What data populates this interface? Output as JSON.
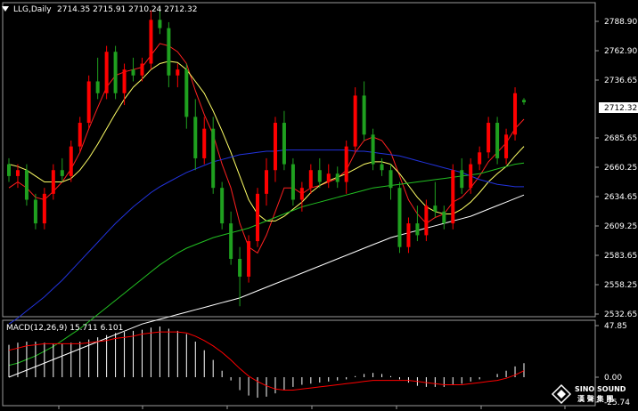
{
  "window": {
    "symbol_title": "LLG,Daily",
    "ohlc_text": "2714.35 2715.91 2710.24 2712.32"
  },
  "price_axis": {
    "ticks": [
      "2788.90",
      "2762.90",
      "2736.65",
      "2712.32",
      "2685.65",
      "2660.25",
      "2634.65",
      "2609.25",
      "2583.65",
      "2558.25",
      "2532.65"
    ],
    "current_price": "2712.32"
  },
  "macd_panel": {
    "label": "MACD(12,26,9) 15.711 6.101",
    "ticks": [
      "47.85",
      "0.00",
      "-25.74"
    ]
  },
  "watermark": {
    "brand_en": "SINO SOUND",
    "brand_cn": "漢 聲 集 團"
  },
  "colors": {
    "background": "#000000",
    "bull_candle": "#ff0000",
    "bear_candle": "#1fa01f",
    "ma_fast": "#ff2020",
    "ma_slow": "#ffff66",
    "ma_mid": "#22c022",
    "ma_blue": "#2233dd",
    "ma_long": "#ffffff",
    "macd_hist": "#ffffff",
    "macd_signal": "#ff0000"
  },
  "chart_data": {
    "type": "candlestick",
    "ylim": [
      2532.65,
      2795
    ],
    "candles": [
      [
        2660,
        2665,
        2645,
        2650
      ],
      [
        2650,
        2660,
        2640,
        2655
      ],
      [
        2655,
        2660,
        2625,
        2630
      ],
      [
        2630,
        2635,
        2605,
        2610
      ],
      [
        2610,
        2640,
        2605,
        2635
      ],
      [
        2635,
        2660,
        2630,
        2655
      ],
      [
        2655,
        2665,
        2645,
        2650
      ],
      [
        2650,
        2680,
        2645,
        2675
      ],
      [
        2675,
        2700,
        2670,
        2695
      ],
      [
        2695,
        2735,
        2690,
        2730
      ],
      [
        2730,
        2750,
        2715,
        2720
      ],
      [
        2720,
        2760,
        2715,
        2755
      ],
      [
        2755,
        2760,
        2715,
        2720
      ],
      [
        2720,
        2745,
        2710,
        2740
      ],
      [
        2740,
        2750,
        2730,
        2735
      ],
      [
        2735,
        2750,
        2730,
        2745
      ],
      [
        2745,
        2790,
        2740,
        2782
      ],
      [
        2782,
        2792,
        2770,
        2775
      ],
      [
        2775,
        2780,
        2725,
        2735
      ],
      [
        2735,
        2745,
        2725,
        2740
      ],
      [
        2740,
        2745,
        2690,
        2700
      ],
      [
        2700,
        2715,
        2655,
        2665
      ],
      [
        2665,
        2700,
        2660,
        2690
      ],
      [
        2690,
        2700,
        2635,
        2640
      ],
      [
        2640,
        2645,
        2605,
        2610
      ],
      [
        2610,
        2620,
        2575,
        2580
      ],
      [
        2580,
        2590,
        2540,
        2565
      ],
      [
        2565,
        2600,
        2560,
        2595
      ],
      [
        2595,
        2640,
        2590,
        2635
      ],
      [
        2635,
        2665,
        2625,
        2655
      ],
      [
        2655,
        2700,
        2645,
        2695
      ],
      [
        2695,
        2705,
        2655,
        2660
      ],
      [
        2660,
        2665,
        2625,
        2630
      ],
      [
        2630,
        2645,
        2620,
        2640
      ],
      [
        2640,
        2660,
        2635,
        2655
      ],
      [
        2655,
        2665,
        2640,
        2645
      ],
      [
        2645,
        2660,
        2640,
        2652
      ],
      [
        2652,
        2658,
        2640,
        2645
      ],
      [
        2645,
        2680,
        2635,
        2675
      ],
      [
        2675,
        2725,
        2670,
        2718
      ],
      [
        2718,
        2730,
        2680,
        2685
      ],
      [
        2685,
        2690,
        2655,
        2660
      ],
      [
        2660,
        2665,
        2650,
        2655
      ],
      [
        2655,
        2660,
        2630,
        2640
      ],
      [
        2640,
        2645,
        2585,
        2590
      ],
      [
        2590,
        2615,
        2585,
        2610
      ],
      [
        2610,
        2625,
        2595,
        2600
      ],
      [
        2600,
        2630,
        2595,
        2625
      ],
      [
        2625,
        2645,
        2615,
        2620
      ],
      [
        2620,
        2625,
        2605,
        2610
      ],
      [
        2610,
        2660,
        2605,
        2655
      ],
      [
        2655,
        2665,
        2635,
        2640
      ],
      [
        2640,
        2665,
        2635,
        2660
      ],
      [
        2660,
        2675,
        2655,
        2670
      ],
      [
        2670,
        2700,
        2665,
        2695
      ],
      [
        2695,
        2700,
        2660,
        2665
      ],
      [
        2665,
        2690,
        2660,
        2685
      ],
      [
        2685,
        2725,
        2680,
        2720
      ],
      [
        2714.35,
        2715.91,
        2710.24,
        2712.32
      ]
    ],
    "overlays": [
      {
        "name": "ma_fast",
        "color": "#ff2020",
        "values": [
          2640,
          2645,
          2640,
          2632,
          2630,
          2637,
          2645,
          2656,
          2670,
          2690,
          2708,
          2725,
          2735,
          2738,
          2740,
          2742,
          2752,
          2762,
          2760,
          2755,
          2745,
          2722,
          2702,
          2685,
          2660,
          2640,
          2610,
          2590,
          2585,
          2600,
          2620,
          2640,
          2640,
          2635,
          2640,
          2642,
          2645,
          2648,
          2655,
          2670,
          2680,
          2683,
          2680,
          2670,
          2650,
          2630,
          2618,
          2610,
          2615,
          2618,
          2628,
          2632,
          2640,
          2650,
          2662,
          2670,
          2678,
          2690,
          2698
        ]
      },
      {
        "name": "ma_slow",
        "color": "#ffff66",
        "values": [
          2660,
          2658,
          2655,
          2650,
          2645,
          2645,
          2645,
          2648,
          2655,
          2665,
          2677,
          2690,
          2703,
          2715,
          2725,
          2732,
          2740,
          2745,
          2747,
          2746,
          2740,
          2730,
          2720,
          2705,
          2688,
          2670,
          2650,
          2630,
          2618,
          2612,
          2612,
          2616,
          2622,
          2628,
          2636,
          2642,
          2646,
          2649,
          2652,
          2656,
          2660,
          2662,
          2662,
          2660,
          2652,
          2642,
          2632,
          2624,
          2620,
          2618,
          2618,
          2622,
          2628,
          2636,
          2645,
          2652,
          2658,
          2667,
          2675
        ]
      },
      {
        "name": "ma_mid",
        "color": "#22c022",
        "values": [
          2490,
          2492,
          2495,
          2498,
          2502,
          2506,
          2511,
          2516,
          2521,
          2527,
          2533,
          2539,
          2545,
          2551,
          2557,
          2563,
          2569,
          2575,
          2580,
          2585,
          2589,
          2592,
          2595,
          2598,
          2600,
          2602,
          2604,
          2606,
          2609,
          2612,
          2615,
          2618,
          2621,
          2624,
          2626,
          2628,
          2630,
          2632,
          2634,
          2636,
          2638,
          2640,
          2641,
          2642,
          2643,
          2644,
          2645,
          2646,
          2647,
          2648,
          2649,
          2650,
          2651,
          2652,
          2654,
          2656,
          2658,
          2660,
          2661
        ]
      },
      {
        "name": "ma_blue",
        "color": "#2233dd",
        "values": [
          2525,
          2530,
          2536,
          2542,
          2548,
          2555,
          2562,
          2570,
          2578,
          2586,
          2594,
          2602,
          2610,
          2617,
          2624,
          2630,
          2636,
          2641,
          2645,
          2649,
          2653,
          2656,
          2659,
          2662,
          2664,
          2666,
          2668,
          2669,
          2670,
          2671,
          2671,
          2672,
          2672,
          2672,
          2672,
          2672,
          2672,
          2672,
          2672,
          2671,
          2671,
          2670,
          2669,
          2668,
          2667,
          2665,
          2663,
          2661,
          2659,
          2657,
          2655,
          2653,
          2650,
          2647,
          2645,
          2643,
          2642,
          2641,
          2641
        ]
      },
      {
        "name": "ma_long",
        "color": "#ffffff",
        "values": [
          2480,
          2483,
          2486,
          2489,
          2492,
          2495,
          2498,
          2501,
          2504,
          2507,
          2510,
          2513,
          2516,
          2519,
          2522,
          2525,
          2527,
          2529,
          2531,
          2533,
          2535,
          2537,
          2539,
          2541,
          2543,
          2545,
          2547,
          2550,
          2553,
          2556,
          2559,
          2562,
          2565,
          2568,
          2571,
          2574,
          2577,
          2580,
          2583,
          2586,
          2589,
          2592,
          2595,
          2598,
          2600,
          2602,
          2604,
          2606,
          2608,
          2610,
          2612,
          2614,
          2616,
          2619,
          2622,
          2625,
          2628,
          2631,
          2634
        ]
      }
    ],
    "macd": {
      "ylim": [
        -25.74,
        47.85
      ],
      "histogram": [
        30,
        32,
        33,
        33,
        32,
        31,
        31,
        32,
        33,
        35,
        37,
        39,
        41,
        42,
        43,
        44,
        46,
        47,
        45,
        43,
        40,
        33,
        25,
        16,
        6,
        -3,
        -12,
        -17,
        -19,
        -18,
        -15,
        -12,
        -9,
        -7,
        -6,
        -5,
        -4,
        -3,
        -2,
        1,
        3,
        4,
        3,
        1,
        -2,
        -5,
        -8,
        -9,
        -9,
        -9,
        -7,
        -6,
        -4,
        -2,
        0,
        3,
        6,
        10,
        13
      ],
      "signal": [
        25,
        27,
        29,
        30,
        31,
        31,
        31,
        31,
        31,
        32,
        33,
        34,
        36,
        37,
        38,
        40,
        41,
        42,
        42,
        42,
        41,
        38,
        34,
        29,
        23,
        16,
        8,
        1,
        -4,
        -8,
        -11,
        -12,
        -12,
        -11,
        -10,
        -9,
        -8,
        -7,
        -6,
        -5,
        -4,
        -3,
        -3,
        -3,
        -3,
        -3,
        -4,
        -5,
        -6,
        -7,
        -7,
        -7,
        -6,
        -5,
        -4,
        -3,
        -1,
        2,
        6
      ]
    }
  }
}
